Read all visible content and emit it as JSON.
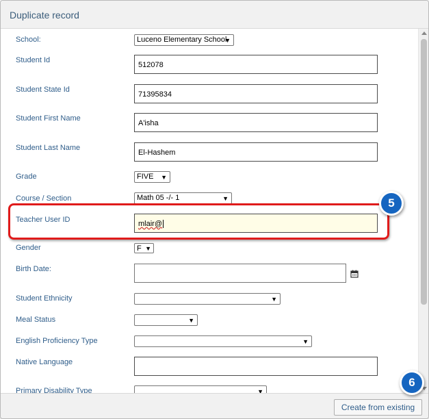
{
  "dialog": {
    "title": "Duplicate record"
  },
  "fields": {
    "school": {
      "label": "School:",
      "value": "Luceno Elementary School"
    },
    "student_id": {
      "label": "Student Id",
      "value": "512078"
    },
    "student_state_id": {
      "label": "Student State Id",
      "value": "71395834"
    },
    "first_name": {
      "label": "Student First Name",
      "value": "A'isha"
    },
    "last_name": {
      "label": "Student Last Name",
      "value": "El-Hashem"
    },
    "grade": {
      "label": "Grade",
      "value": "FIVE"
    },
    "course_section": {
      "label": "Course / Section",
      "value": "Math 05 -/- 1"
    },
    "teacher_user_id": {
      "label": "Teacher User ID",
      "value": "mlair@"
    },
    "gender": {
      "label": "Gender",
      "value": "F"
    },
    "birth_date": {
      "label": "Birth Date:",
      "value": ""
    },
    "ethnicity": {
      "label": "Student Ethnicity",
      "value": ""
    },
    "meal_status": {
      "label": "Meal Status",
      "value": ""
    },
    "english_proficiency": {
      "label": "English Proficiency Type",
      "value": ""
    },
    "native_language": {
      "label": "Native Language",
      "value": ""
    },
    "primary_disability": {
      "label": "Primary Disability Type",
      "value": ""
    }
  },
  "callouts": {
    "step5": "5",
    "step6": "6"
  },
  "footer": {
    "create_button": "Create from existing"
  },
  "colors": {
    "label": "#2f5d8a",
    "highlight": "#e01b1b",
    "badge": "#1565c0",
    "active_input_bg": "#fffde7"
  },
  "icons": {
    "calendar": "calendar-icon"
  }
}
